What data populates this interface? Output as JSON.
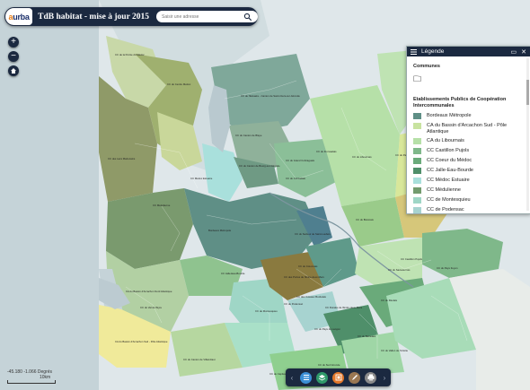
{
  "header": {
    "logo_text_a": "a",
    "logo_text_b": "urba",
    "title": "TdB habitat - mise à jour 2015",
    "search_placeholder": "Saisir une adresse"
  },
  "map_controls": {
    "zoom_in": "+",
    "zoom_out": "−",
    "home_icon": "home-icon"
  },
  "map": {
    "water_color": "#c9d6dc",
    "land_color": "#e9ecea",
    "labels": [
      "CC de la Pointe du Médoc",
      "CC du Centre Médoc",
      "CC des Lacs Médocains",
      "CC Médulienne",
      "CC Médoc Estuaire",
      "Bordeaux Métropole",
      "CC de l'Estuaire - Canton de Saint-Ciers-sur-Gironde",
      "CC du Canton de Blaye",
      "CC du Canton de Bourg-sur-Gironde",
      "CC du Cubzadais",
      "CC du Libournais",
      "CC du Secteur de Saint-Loubès",
      "CC de Montesquieu",
      "CC de Podensac",
      "CA du Bassin d'Arcachon Nord Atlantique",
      "CA du Bassin d'Arcachon Sud - Pôle Atlantique",
      "CC Castillon Pujols",
      "CC du Réolais",
      "CC du Bazadais",
      "CC du Sauveterrois",
      "CC Jalle-Eau-Bourde",
      "CC du Val de l'Eyre",
      "CC des Coteaux Bordelais",
      "CC du Créonnais",
      "CC du Brannais",
      "CC des Portes de l'Entre-deux-Mers",
      "CC du Vallon de l'Artolie",
      "CC du Pays Foyen",
      "CC du Canton de Villandraut",
      "CC du Sud Gironde",
      "CC du Pays de Langon",
      "CC de Captieux-Grignols",
      "CC Rurales de l'Entre-deux-Mers",
      "CC du Grand Cubzaguais",
      "CC du Fronsadais",
      "CC du Pays de Coutras"
    ]
  },
  "legend": {
    "title": "Légende",
    "section1": "Communes",
    "section2": "Etablissements Publics de Coopération Intercommunales",
    "items": [
      {
        "label": "Bordeaux Métropole",
        "color": "#5f8f86"
      },
      {
        "label": "CA du Bassin d'Arcachon Sud - Pôle Atlantique",
        "color": "#c8e3a0"
      },
      {
        "label": "CA du Libournais",
        "color": "#b6e0a8"
      },
      {
        "label": "CC Castillon Pujols",
        "color": "#7fb88a"
      },
      {
        "label": "CC Coeur du Médoc",
        "color": "#6aaa7a"
      },
      {
        "label": "CC Jalle-Eau-Bourde",
        "color": "#4f8f6a"
      },
      {
        "label": "CC Médoc Estuaire",
        "color": "#a9e0dc"
      },
      {
        "label": "CC Médulienne",
        "color": "#739b6e"
      },
      {
        "label": "CC de Montesquieu",
        "color": "#9fd6c6"
      },
      {
        "label": "CC de Podensac",
        "color": "#a7d3d0"
      }
    ]
  },
  "scale": {
    "coords": "-45.180 -1.066 Degrés",
    "label": "10km"
  },
  "toolbar": {
    "buttons": [
      {
        "name": "layer-list-button",
        "color": "#3b8fd6"
      },
      {
        "name": "basemap-button",
        "color": "#2f9a6a"
      },
      {
        "name": "legend-button",
        "color": "#e3772a"
      },
      {
        "name": "draw-button",
        "color": "#9a7752"
      },
      {
        "name": "print-button",
        "color": "#8a8a8a"
      }
    ]
  }
}
